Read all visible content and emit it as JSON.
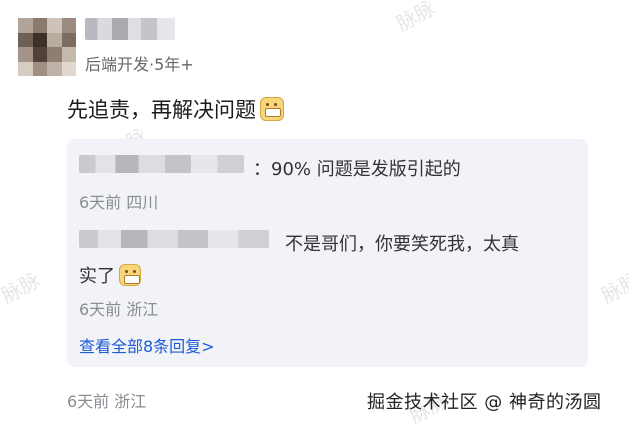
{
  "post": {
    "author_role": "后端开发·5年+",
    "comment_text": "先追责，再解决问题"
  },
  "replies": {
    "reply1": {
      "text": "：90% 问题是发版引起的",
      "meta": "6天前 四川"
    },
    "reply2": {
      "text_line1": "不是哥们，你要笑死我，太真",
      "text_line2": "实了",
      "meta": "6天前 浙江"
    },
    "view_all_link": "查看全部8条回复>"
  },
  "footer": {
    "meta": "6天前 浙江",
    "brand_watermark": "掘金技术社区 @ 神奇的汤圆"
  },
  "watermarks": [
    "脉脉",
    "脉脉",
    "脉脉",
    "脉脉",
    "脉脉",
    "脉脉"
  ],
  "colors": {
    "link": "#1e5bd6",
    "panel_bg": "#f2f3f8",
    "meta": "#8a8d93"
  }
}
